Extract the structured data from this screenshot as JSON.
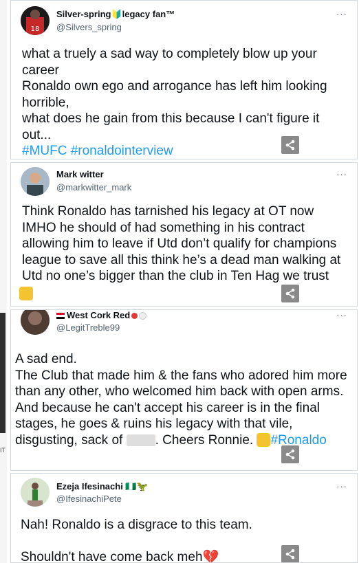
{
  "tweets": [
    {
      "name": "Silver-spring🔰legacy fan™",
      "handle": "@Silvers_spring",
      "text": "what a truely a sad way to completely blow up your career\nRonaldo own ego and arrogance has left him looking horrible,\nwhat does he gain from this because I can't figure it out...",
      "hashtags": "#MUFC #ronaldointerview",
      "more": "···"
    },
    {
      "name": "Mark witter",
      "handle": "@markwitter_mark",
      "text": "Think Ronaldo has tarnished his legacy at OT now IMHO he should of had something in his contract allowing him to leave if Utd don’t qualify for champions league  to save all this think he’s a dead man walking at Utd no one’s bigger than the club in Ten Hag we trust",
      "more": "···"
    },
    {
      "name": "West Cork Red",
      "handle": "@LegitTreble99",
      "text_a": "A sad end.\nThe Club that made him & the fans who adored him more than any other, who welcomed him back with open arms.\nAnd because he can't accept his career is in the final stages, he goes & ruins his legacy with that vile, disgusting, sack of",
      "text_b": ". Cheers Ronnie.",
      "hashtag": "#Ronaldo",
      "more": "···"
    },
    {
      "name": "Ezeja Ifesinachi 🇳🇬🦖",
      "handle": "@IfesinachiPete",
      "text": "Nah! Ronaldo is a disgrace to this team.\n\nShouldn't have come back meh💔",
      "more": "···"
    }
  ],
  "side_fragment": "IT",
  "icons": {
    "share": "share-icon",
    "more": "more-icon",
    "thumbs_up": "thumbs-up-emoji"
  },
  "colors": {
    "link": "#1d9bf0",
    "secondary": "#536471",
    "border": "#cfd9de",
    "share_bg": "#8a8a8a"
  }
}
